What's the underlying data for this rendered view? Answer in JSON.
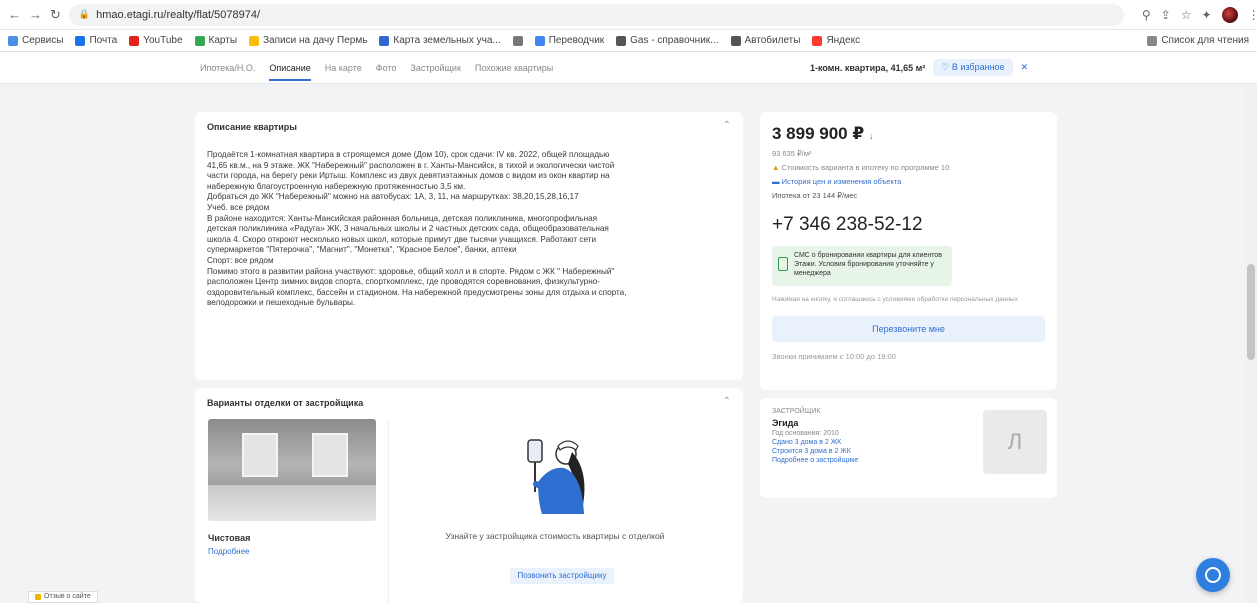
{
  "browser": {
    "url": "hmao.etagi.ru/realty/flat/5078974/",
    "bookmarks": [
      {
        "label": "Сервисы",
        "color": "#4a90e2"
      },
      {
        "label": "Почта",
        "color": "#1a73e8"
      },
      {
        "label": "YouTube",
        "color": "#e62117"
      },
      {
        "label": "Карты",
        "color": "#34a853"
      },
      {
        "label": "Записи на дачу Пермь",
        "color": "#fbbc05"
      },
      {
        "label": "Карта земельных уча...",
        "color": "#3367d6"
      },
      {
        "label": "",
        "color": "#777777"
      },
      {
        "label": "Переводчик",
        "color": "#4285f4"
      },
      {
        "label": "Gas - справочник...",
        "color": "#555555"
      },
      {
        "label": "Автобилеты",
        "color": "#555555"
      },
      {
        "label": "Яндекс",
        "color": "#ff3b30"
      }
    ],
    "reading_list": "Список для чтения"
  },
  "site_header": {
    "tabs": [
      {
        "label": "Ипотека/Н.О.",
        "active": false
      },
      {
        "label": "Описание",
        "active": true
      },
      {
        "label": "На карте",
        "active": false
      },
      {
        "label": "Фото",
        "active": false
      },
      {
        "label": "Застройщик",
        "active": false
      },
      {
        "label": "Похожие квартиры",
        "active": false
      }
    ],
    "object_title": "1-комн. квартира, 41,65 м²",
    "favorite_label": "В избранное",
    "close_label": "✕"
  },
  "description": {
    "title": "Описание квартиры",
    "lines": [
      "Продаётся 1-комнатная квартира в строящемся доме (Дом 10), срок сдачи: IV кв. 2022, общей площадью",
      "41,65 кв.м., на 9 этаже. ЖК \"Набережный\" расположен в г. Ханты-Мансийск, в тихой и экологически чистой",
      "части города, на берегу реки Иртыш. Комплекс из двух девятиэтажных домов с видом из окон квартир на",
      "набережную благоустроенную набережную протяженностью 3,5 км.",
      "Добраться до ЖК \"Набережный\" можно на автобусах: 1А, 3, 11, на маршрутках: 38,20,15,28,16,17",
      "Учеб. все рядом",
      "В районе находится: Ханты-Мансийская районная больница, детская поликлиника, многопрофильная",
      "детская поликлиника «Радуга» ЖК, 3 начальных школы и 2 частных детских сада, общеобразовательная",
      "школа 4. Скоро откроют несколько новых школ, которые примут две тысячи учащихся. Работают сети",
      "супермаркетов \"Пятерочка\", \"Магнит\", \"Монетка\", \"Красное Белое\", банки, аптеки",
      "Спорт: все рядом",
      "Помимо этого в развитии района участвуют: здоровье, общий холл и в спорте. Рядом с ЖК \" Набережный\"",
      "расположен Центр зимних видов спорта, спорткомплекс, где проводятся соревнования, физкультурно-",
      "оздоровительный комплекс, бассейн и стадионом. На набережной предусмотрены зоны для отдыха и спорта,",
      "велодорожки и пешеходные бульвары."
    ]
  },
  "repair": {
    "title": "Варианты отделки от застройщика",
    "option_title": "Чистовая",
    "option_link": "Подробнее",
    "cta_text": "Узнайте у застройщика стоимость квартиры с отделкой",
    "cta_button": "Позвонить застройщику"
  },
  "sidebar": {
    "price": "3 899 900 ₽",
    "price_per_m2": "93 635 ₽/м²",
    "mortgage_note": "Стоимость варианта в ипотеку по программе 10",
    "graph_note": "История цен и изменения объекта",
    "mortgage_calc": "Ипотека от 23 144 ₽/мес",
    "phone": "+7 346 238-52-12",
    "promo_text": "СМС о бронировании квартиры для клиентов Этажи. Условия бронирования уточняйте у менеджера",
    "fine_print": "Нажимая на кнопку, я соглашаюсь с условиями обработки персональных данных",
    "call_button": "Перезвоните мне",
    "hours": "Звонки принимаем с 10:00 до 19:00"
  },
  "developer": {
    "label": "ЗАСТРОЙЩИК",
    "name": "Эгида",
    "line1": "Год основания: 2010",
    "line2": "Сдано 3 дома в 2 ЖК",
    "line3": "Строится 3 дома в 2 ЖК",
    "line4": "Подробнее о застройщике",
    "logo_letter": "Л"
  },
  "feedback": {
    "label": "Отзыв о сайте"
  }
}
